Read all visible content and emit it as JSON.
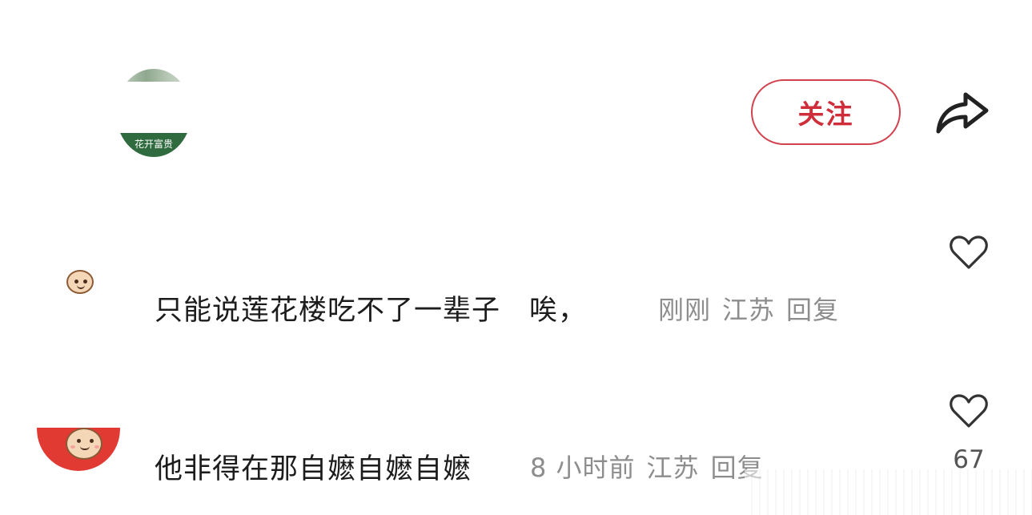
{
  "author": {
    "avatar_caption": "花开富贵"
  },
  "header": {
    "follow_label": "关注"
  },
  "comments": [
    {
      "text": "只能说莲花楼吃不了一辈子　唉，",
      "time": "刚刚",
      "location": "江苏",
      "reply_label": "回复",
      "likes": ""
    },
    {
      "text": "他非得在那自嬷自嬷自嬷",
      "time": "8 小时前",
      "location": "江苏",
      "reply_label": "回复",
      "likes": "67"
    }
  ],
  "colors": {
    "accent": "#d02d3b",
    "meta_text": "#8d8d8d",
    "body_text": "#1c1c1c"
  },
  "icons": [
    "share-icon",
    "heart-icon"
  ]
}
